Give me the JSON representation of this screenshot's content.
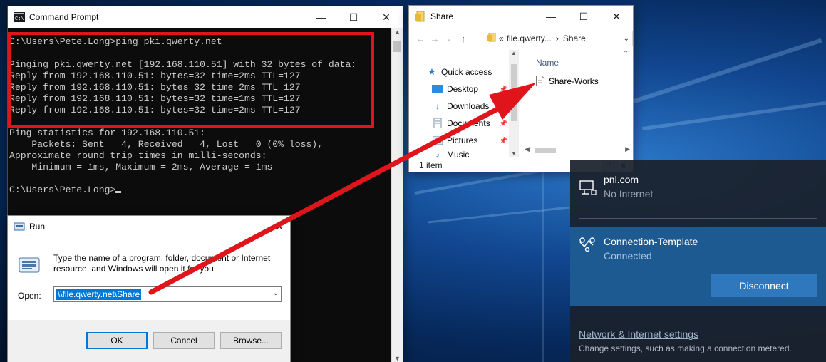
{
  "cmd": {
    "title": "Command Prompt",
    "lines": [
      "C:\\Users\\Pete.Long>ping pki.qwerty.net",
      "",
      "Pinging pki.qwerty.net [192.168.110.51] with 32 bytes of data:",
      "Reply from 192.168.110.51: bytes=32 time=2ms TTL=127",
      "Reply from 192.168.110.51: bytes=32 time=2ms TTL=127",
      "Reply from 192.168.110.51: bytes=32 time=1ms TTL=127",
      "Reply from 192.168.110.51: bytes=32 time=2ms TTL=127",
      "",
      "Ping statistics for 192.168.110.51:",
      "    Packets: Sent = 4, Received = 4, Lost = 0 (0% loss),",
      "Approximate round trip times in milli-seconds:",
      "    Minimum = 1ms, Maximum = 2ms, Average = 1ms",
      "",
      "C:\\Users\\Pete.Long>"
    ]
  },
  "run": {
    "title": "Run",
    "description": "Type the name of a program, folder, document or Internet resource, and Windows will open it for you.",
    "open_label": "Open:",
    "open_value": "\\\\file.qwerty.net\\Share",
    "ok_label": "OK",
    "cancel_label": "Cancel",
    "browse_label": "Browse..."
  },
  "explorer": {
    "title": "Share",
    "breadcrumb_prefix": "«",
    "breadcrumb_parent": "file.qwerty...",
    "breadcrumb_sep": "›",
    "breadcrumb_current": "Share",
    "nav_items": [
      "Quick access",
      "Desktop",
      "Downloads",
      "Documents",
      "Pictures",
      "Music"
    ],
    "column_name": "Name",
    "files": [
      "Share-Works"
    ],
    "status": "1 item"
  },
  "network": {
    "networks": [
      {
        "name": "pnl.com",
        "status": "No Internet"
      },
      {
        "name": "Connection-Template",
        "status": "Connected"
      }
    ],
    "disconnect_label": "Disconnect",
    "settings_link": "Network & Internet settings",
    "settings_desc": "Change settings, such as making a connection metered."
  },
  "colors": {
    "highlight": "#e0141b",
    "accent": "#0078d7",
    "active_network": "#1e5a92"
  }
}
